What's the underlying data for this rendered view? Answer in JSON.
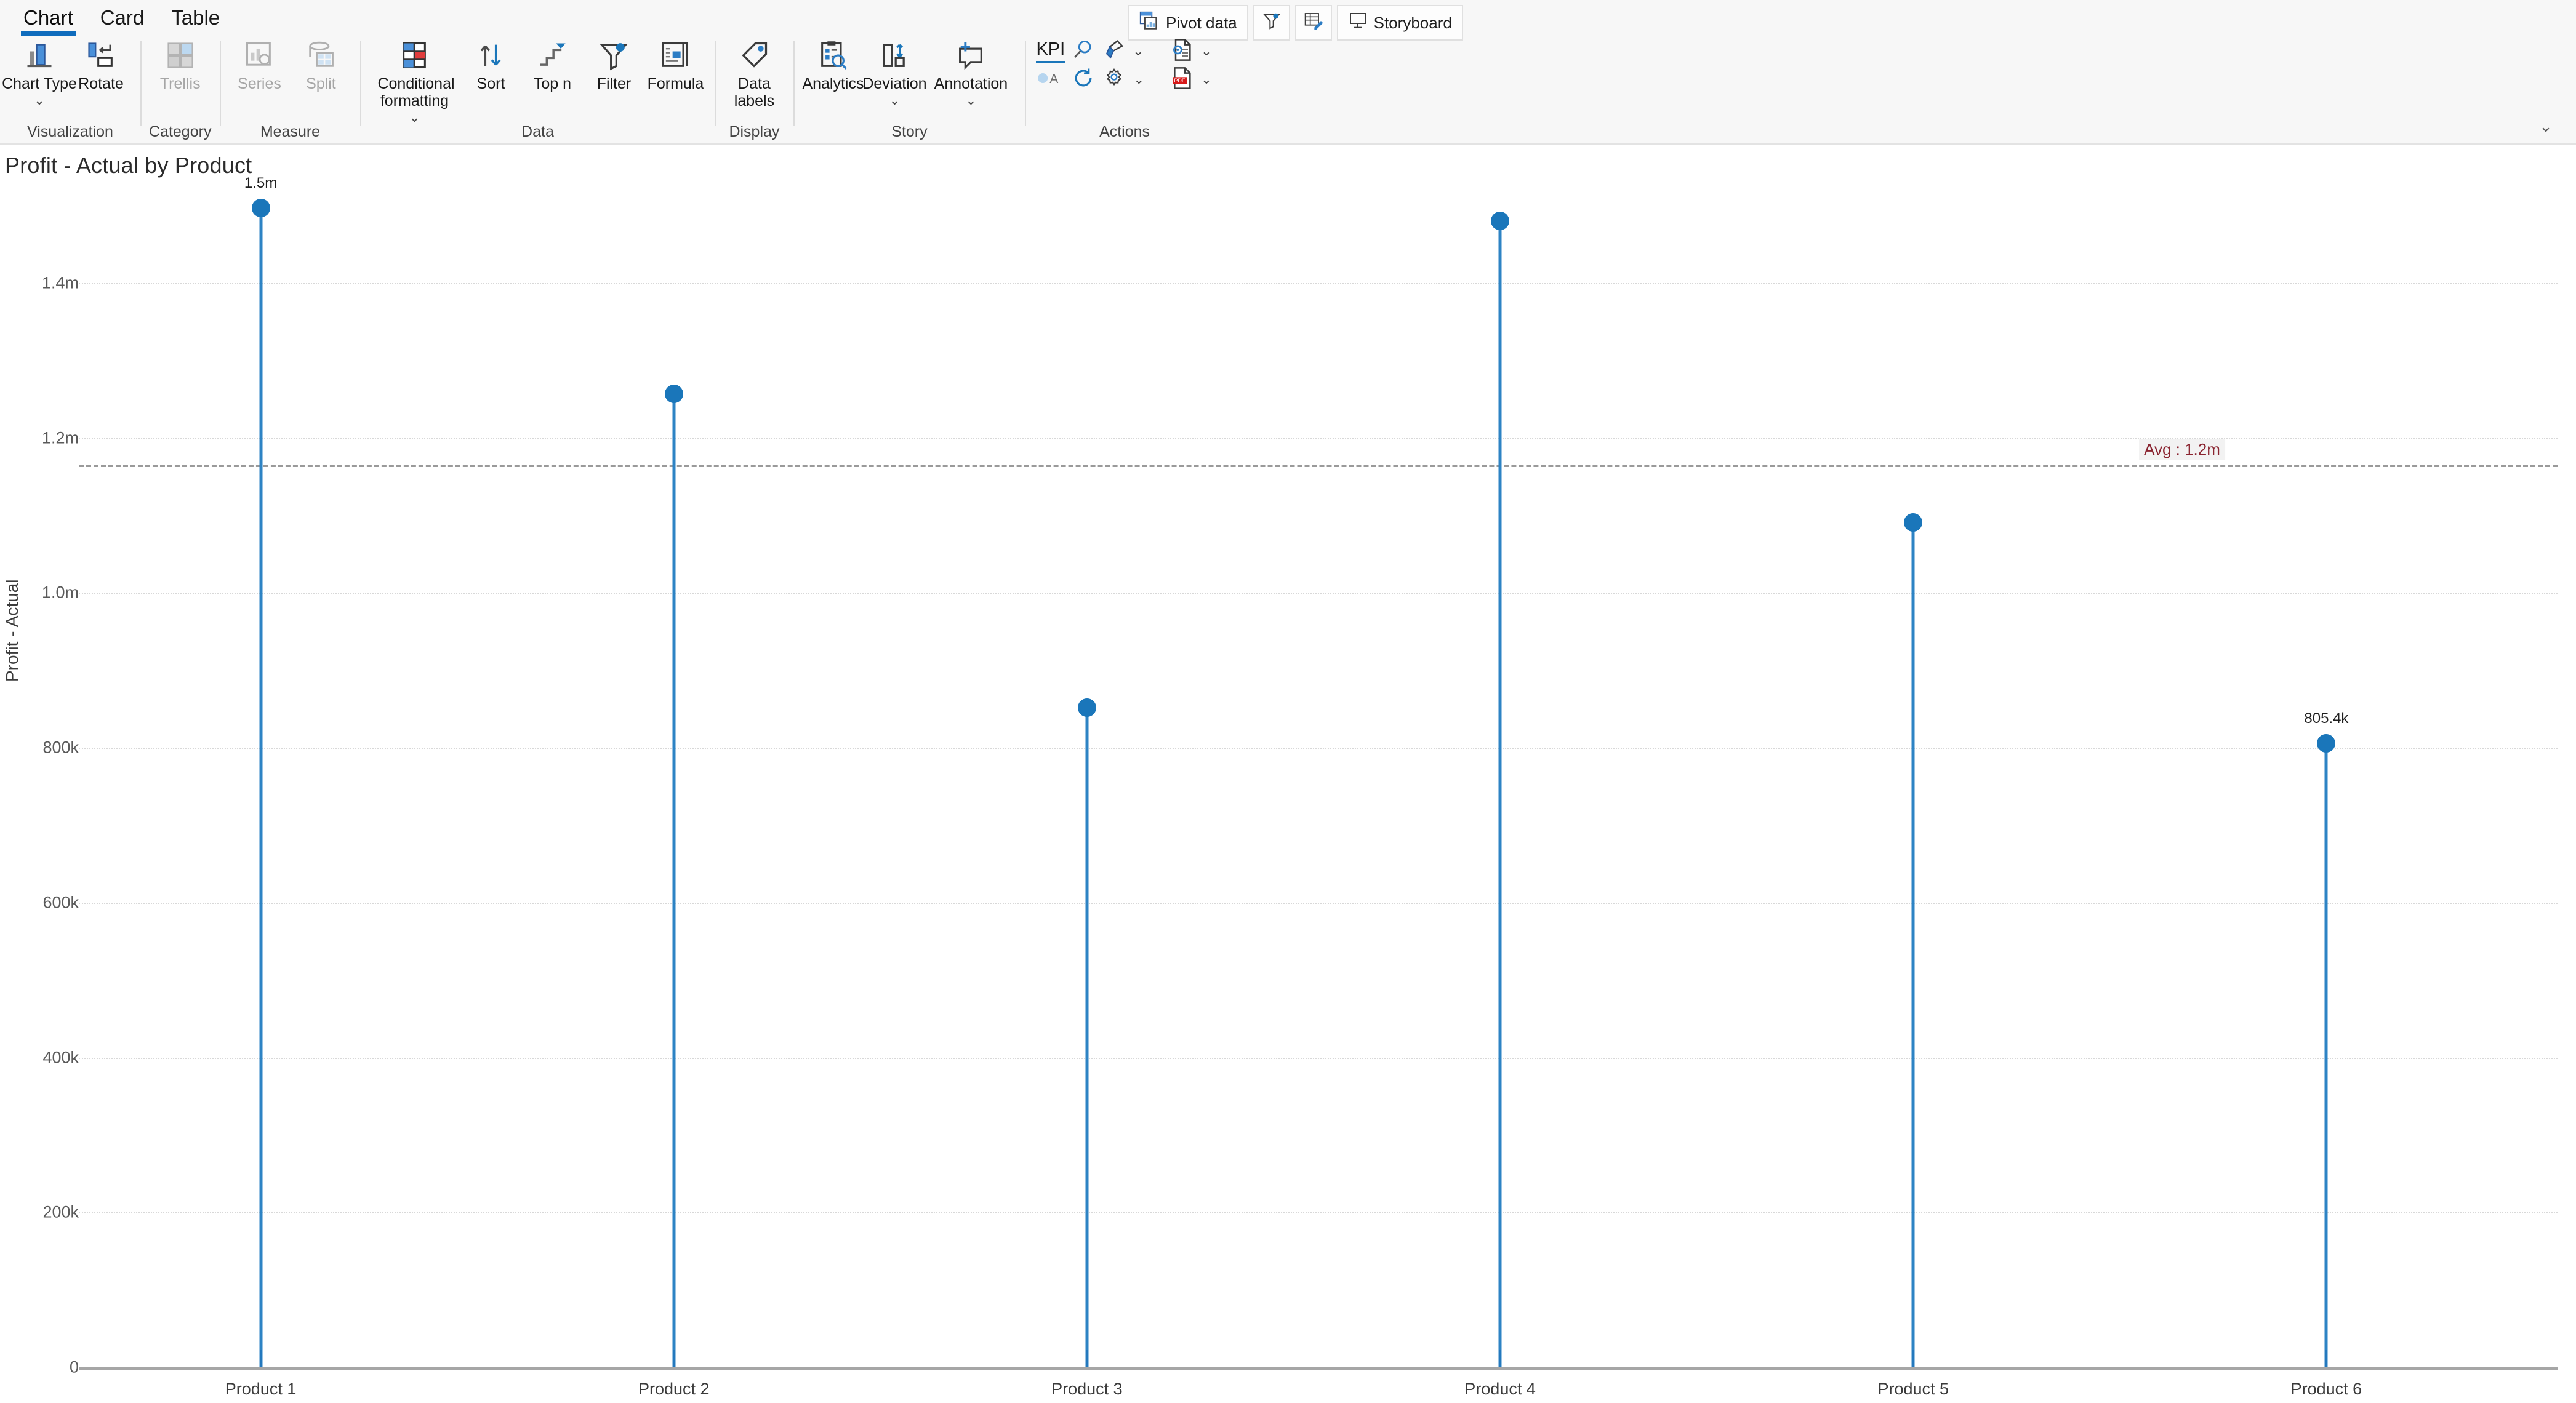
{
  "ribbon": {
    "tabs": [
      {
        "label": "Chart",
        "active": true
      },
      {
        "label": "Card",
        "active": false
      },
      {
        "label": "Table",
        "active": false
      }
    ],
    "collapse_icon": "chevron-down-icon",
    "groups": [
      {
        "name": "Visualization",
        "label": "Visualization",
        "buttons": [
          {
            "label": "Chart Type",
            "icon": "bar-chart-icon",
            "has_chevron": true,
            "disabled": false
          },
          {
            "label": "Rotate",
            "icon": "rotate-axis-icon",
            "has_chevron": false,
            "disabled": false
          }
        ]
      },
      {
        "name": "Category",
        "label": "Category",
        "buttons": [
          {
            "label": "Trellis",
            "icon": "trellis-grid-icon",
            "has_chevron": false,
            "disabled": true
          }
        ]
      },
      {
        "name": "Measure",
        "label": "Measure",
        "buttons": [
          {
            "label": "Series",
            "icon": "series-chart-icon",
            "has_chevron": false,
            "disabled": true
          },
          {
            "label": "Split",
            "icon": "split-stack-icon",
            "has_chevron": false,
            "disabled": true
          }
        ]
      },
      {
        "name": "Data",
        "label": "Data",
        "buttons": [
          {
            "label": "Conditional formatting",
            "icon": "conditional-formatting-icon",
            "has_chevron": true,
            "disabled": false
          },
          {
            "label": "Sort",
            "icon": "sort-arrows-icon",
            "has_chevron": false,
            "disabled": false
          },
          {
            "label": "Top n",
            "icon": "top-n-icon",
            "has_chevron": false,
            "disabled": false
          },
          {
            "label": "Filter",
            "icon": "funnel-filter-icon",
            "has_chevron": false,
            "disabled": false
          },
          {
            "label": "Formula",
            "icon": "formula-icon",
            "has_chevron": false,
            "disabled": false
          }
        ]
      },
      {
        "name": "Display",
        "label": "Display",
        "buttons": [
          {
            "label": "Data labels",
            "icon": "data-label-tag-icon",
            "has_chevron": false,
            "disabled": false
          }
        ]
      },
      {
        "name": "Story",
        "label": "Story",
        "buttons": [
          {
            "label": "Analytics",
            "icon": "analytics-clipboard-icon",
            "has_chevron": false,
            "disabled": false
          },
          {
            "label": "Deviation",
            "icon": "deviation-icon",
            "has_chevron": true,
            "disabled": false
          },
          {
            "label": "Annotation",
            "icon": "annotation-add-icon",
            "has_chevron": true,
            "disabled": false
          }
        ]
      },
      {
        "name": "Actions",
        "label": "Actions",
        "mini_buttons": [
          {
            "label": "KPI",
            "icon": "kpi-icon",
            "has_chevron": false
          },
          {
            "label": "",
            "icon": "search-icon",
            "has_chevron": false
          },
          {
            "label": "",
            "icon": "paint-brush-icon",
            "has_chevron": true
          },
          {
            "label": "",
            "icon": "bubble-label-A-icon",
            "has_chevron": false
          },
          {
            "label": "",
            "icon": "refresh-icon",
            "has_chevron": false
          },
          {
            "label": "",
            "icon": "settings-gear-icon",
            "has_chevron": true
          }
        ],
        "export_buttons": [
          {
            "label": "",
            "icon": "export-document-icon",
            "has_chevron": true
          },
          {
            "label": "",
            "icon": "export-pdf-icon",
            "has_chevron": true
          }
        ]
      }
    ],
    "quick_buttons": [
      {
        "label": "Pivot data",
        "icon": "pivot-data-icon"
      },
      {
        "label": "",
        "icon": "funnel-filter-icon"
      },
      {
        "label": "",
        "icon": "edit-table-icon"
      },
      {
        "label": "Storyboard",
        "icon": "storyboard-icon"
      }
    ]
  },
  "chart_data": {
    "type": "scatter",
    "subtype": "lollipop",
    "title": "Profit - Actual by Product",
    "xlabel": "",
    "ylabel": "Profit - Actual",
    "categories": [
      "Product 1",
      "Product 2",
      "Product 3",
      "Product 4",
      "Product 5",
      "Product 6"
    ],
    "values": [
      1497000,
      1257000,
      852000,
      1480000,
      1091000,
      805400
    ],
    "value_labels": [
      "1.5m",
      "",
      "",
      "",
      "",
      "805.4k"
    ],
    "ylim": [
      0,
      1500000
    ],
    "yticks": [
      0,
      200000,
      400000,
      600000,
      800000,
      1000000,
      1200000,
      1400000
    ],
    "ytick_labels": [
      "0",
      "200k",
      "400k",
      "600k",
      "800k",
      "1.0m",
      "1.2m",
      "1.4m"
    ],
    "grid": true,
    "legend": "none",
    "annotations": [
      {
        "type": "average-line",
        "label": "Avg : 1.2m",
        "value": 1165400,
        "color": "#8a2430",
        "line_color": "#9a9a9a",
        "style": "dashed"
      }
    ],
    "series_color": "#1a76ba",
    "stem_color": "#2d83c4"
  }
}
